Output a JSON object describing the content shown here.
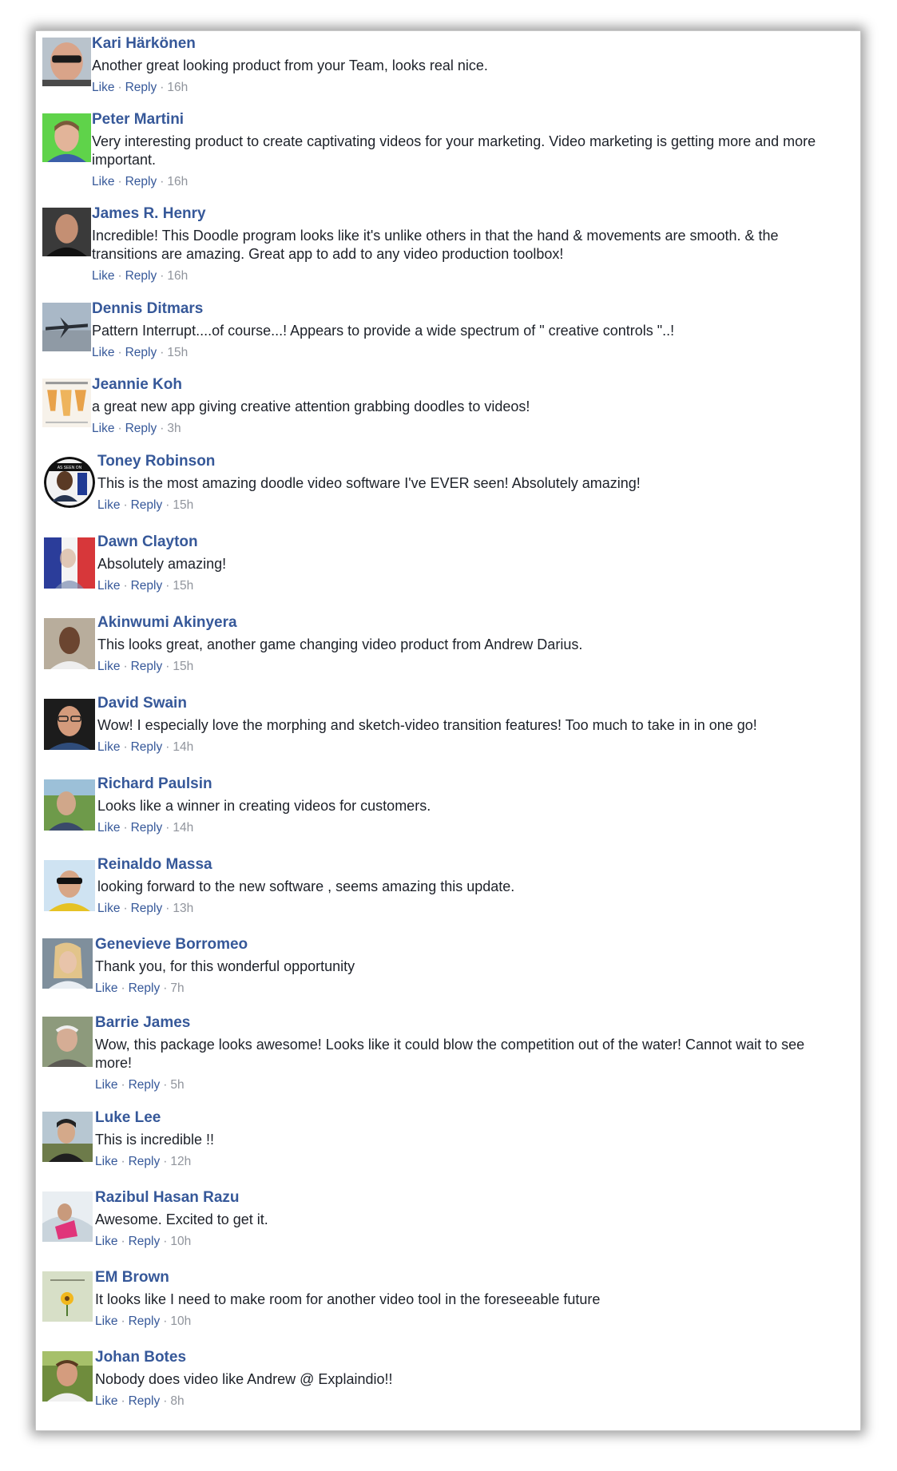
{
  "action_labels": {
    "like": "Like",
    "reply": "Reply",
    "separator": "·"
  },
  "comments": [
    {
      "name": "Kari Härkönen",
      "text": "Another great looking product from your Team, looks real nice.",
      "time": "16h"
    },
    {
      "name": "Peter Martini",
      "text": "Very interesting product to create captivating videos for your marketing. Video marketing is getting more and more important.",
      "time": "16h"
    },
    {
      "name": "James R. Henry",
      "text": "Incredible! This Doodle program looks like it's unlike others in that the hand & movements are smooth. & the transitions are amazing. Great app to add to any video production toolbox!",
      "time": "16h"
    },
    {
      "name": "Dennis Ditmars",
      "text": "Pattern Interrupt....of course...! Appears to provide a wide spectrum of \" creative controls \"..!",
      "time": "15h"
    },
    {
      "name": "Jeannie Koh",
      "text": "a great new app giving creative attention grabbing doodles to videos!",
      "time": "3h"
    },
    {
      "name": "Toney Robinson",
      "text": "This is the most amazing doodle video software I've EVER seen! Absolutely amazing!",
      "time": "15h",
      "avatar_badge": "AS SEEN ON"
    },
    {
      "name": "Dawn Clayton",
      "text": "Absolutely amazing!",
      "time": "15h"
    },
    {
      "name": "Akinwumi Akinyera",
      "text": "This looks great, another game changing video product from Andrew Darius.",
      "time": "15h"
    },
    {
      "name": "David Swain",
      "text": "Wow! I especially love the morphing and sketch-video transition features! Too much to take in in one go!",
      "time": "14h"
    },
    {
      "name": "Richard Paulsin",
      "text": "Looks like a winner in creating videos for customers.",
      "time": "14h"
    },
    {
      "name": "Reinaldo Massa",
      "text": "looking forward to the new software , seems amazing this update.",
      "time": "13h"
    },
    {
      "name": "Genevieve Borromeo",
      "text": "Thank you, for this wonderful opportunity",
      "time": "7h"
    },
    {
      "name": "Barrie James",
      "text": "Wow, this package looks awesome! Looks like it could blow the competition out of the water! Cannot wait to see more!",
      "time": "5h"
    },
    {
      "name": "Luke Lee",
      "text": "This is incredible !!",
      "time": "12h"
    },
    {
      "name": "Razibul Hasan Razu",
      "text": "Awesome. Excited to get it.",
      "time": "10h"
    },
    {
      "name": "EM Brown",
      "text": "It looks like I need to make room for another video tool in the foreseeable future",
      "time": "10h"
    },
    {
      "name": "Johan Botes",
      "text": "Nobody does video like Andrew @ Explaindio!!",
      "time": "8h"
    }
  ]
}
